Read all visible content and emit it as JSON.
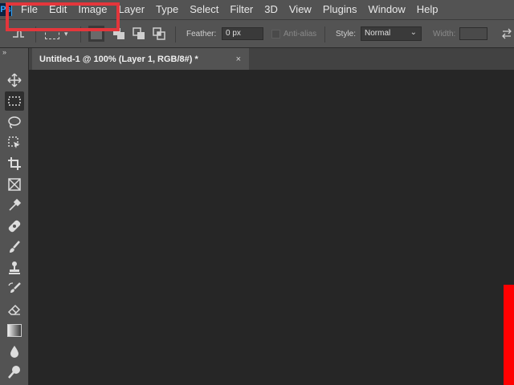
{
  "app": {
    "logo_text": "Ps"
  },
  "menu": [
    "File",
    "Edit",
    "Image",
    "Layer",
    "Type",
    "Select",
    "Filter",
    "3D",
    "View",
    "Plugins",
    "Window",
    "Help"
  ],
  "options_bar": {
    "feather_label": "Feather:",
    "feather_value": "0 px",
    "antialias_label": "Anti-alias",
    "style_label": "Style:",
    "style_value": "Normal",
    "width_label": "Width:"
  },
  "tabs": [
    {
      "title": "Untitled-1 @ 100% (Layer 1, RGB/8#) *",
      "close": "×"
    }
  ],
  "tools": {
    "collapse_glyph": "»",
    "items": [
      {
        "icon": "move-icon",
        "active": false
      },
      {
        "icon": "rectangular-marquee-icon",
        "active": true
      },
      {
        "icon": "lasso-icon",
        "active": false
      },
      {
        "icon": "object-selection-icon",
        "active": false
      },
      {
        "icon": "crop-icon",
        "active": false
      },
      {
        "icon": "frame-icon",
        "active": false
      },
      {
        "icon": "eyedropper-icon",
        "active": false
      },
      {
        "icon": "spot-healing-brush-icon",
        "active": false
      },
      {
        "icon": "brush-icon",
        "active": false
      },
      {
        "icon": "clone-stamp-icon",
        "active": false
      },
      {
        "icon": "history-brush-icon",
        "active": false
      },
      {
        "icon": "eraser-icon",
        "active": false
      },
      {
        "icon": "gradient-icon",
        "active": false
      },
      {
        "icon": "blur-icon",
        "active": false
      },
      {
        "icon": "dodge-icon",
        "active": false
      }
    ]
  },
  "colors": {
    "menubar_bg": "#535353",
    "canvas_bg": "#262626",
    "annotation_red": "#e4363b",
    "accent_blue": "#31a8ff"
  }
}
